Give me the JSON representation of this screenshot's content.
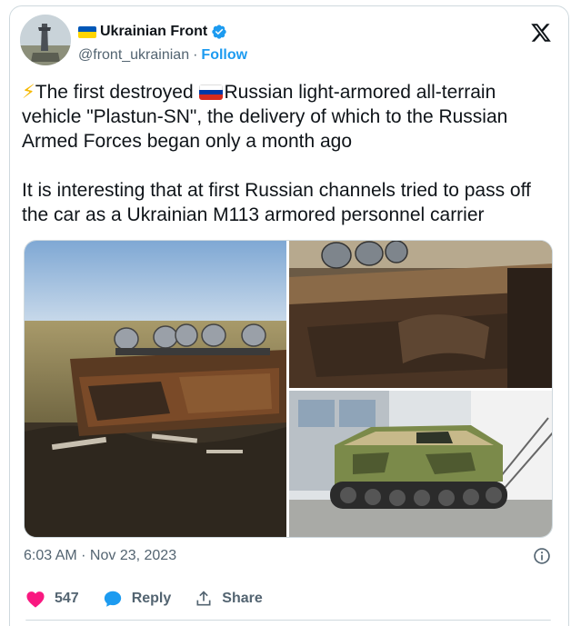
{
  "author": {
    "display_name": "Ukrainian Front",
    "handle": "@front_ukrainian",
    "separator": "·",
    "follow_label": "Follow",
    "flag": "ukraine-flag-icon",
    "verified": true
  },
  "tweet": {
    "line1_after_bolt": "The first destroyed ",
    "line1_after_flag": "Russian light-armored all-terrain vehicle \"Plastun-SN\", the delivery of which to the Russian Armed Forces began only a month ago",
    "paragraph2": "It is interesting that at first Russian channels tried to pass off the car as a Ukrainian M113 armored personnel carrier"
  },
  "media": {
    "images": [
      "destroyed-vehicle-field-photo",
      "burned-hull-closeup-photo",
      "plastun-sn-vehicle-photo"
    ]
  },
  "meta": {
    "timestamp": "6:03 AM · Nov 23, 2023"
  },
  "actions": {
    "like_count": "547",
    "reply_label": "Reply",
    "share_label": "Share"
  },
  "colors": {
    "accent": "#1d9bf0",
    "like": "#f91880",
    "secondary_text": "#536471",
    "border": "#cfd9de"
  }
}
